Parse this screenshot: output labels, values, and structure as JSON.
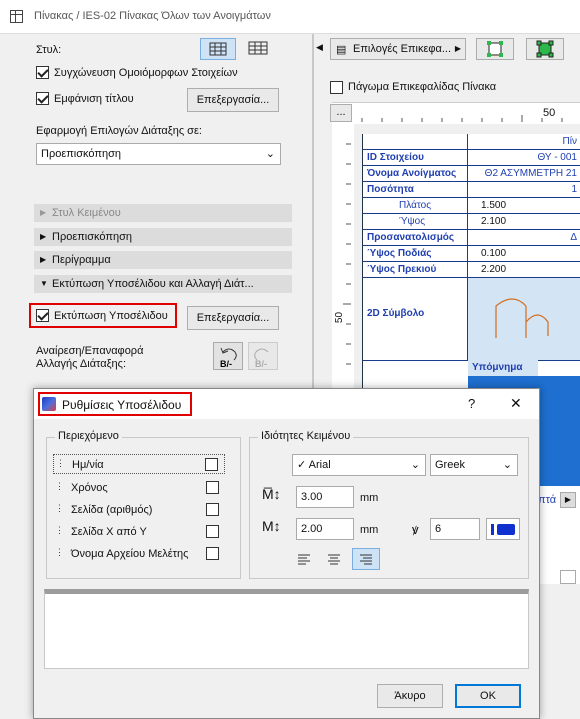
{
  "window": {
    "title": "Πίνακας / IES-02 Πίνακας Όλων των Ανοιγμάτων"
  },
  "left": {
    "style_label": "Στυλ:",
    "merge_label": "Συγχώνευση Ομοιόμορφων Στοιχείων",
    "show_title_label": "Εμφάνιση τίτλου",
    "edit_btn": "Επεξεργασία...",
    "apply_label": "Εφαρμογή Επιλογών Διάταξης σε:",
    "apply_value": "Προεπισκόπηση",
    "sections": [
      "Στυλ Κειμένου",
      "Προεπισκόπηση",
      "Περίγραμμα",
      "Εκτύπωση Υποσέλιδου και Αλλαγή Διάτ..."
    ],
    "print_footer_label": "Εκτύπωση Υποσέλιδου",
    "print_footer_edit_btn": "Επεξεργασία...",
    "undo_label": "Αναίρεση/Επαναφορά Αλλαγής Διάταξης:"
  },
  "right": {
    "options_btn": "Επιλογές Επικεφα...",
    "freeze_label": "Πάγωμα Επικεφαλίδας Πίνακα",
    "ruler_num": "50",
    "vruler_num": "50",
    "dots_btn": "...",
    "table_header": "Πίν",
    "rows": [
      {
        "k": "ID Στοιχείου",
        "v": "ΘΥ - 001"
      },
      {
        "k": "Όνομα Ανοίγματος",
        "v": "Θ2 ΑΣΥΜΜΕΤΡΗ 21"
      },
      {
        "k": "Ποσότητα",
        "v": "1"
      },
      {
        "k": "Πλάτος",
        "v": "1.500"
      },
      {
        "k": "Ύψος",
        "v": "2.100"
      },
      {
        "k": "Προσανατολισμός",
        "v": "Δ"
      },
      {
        "k": "Ύψος Ποδιάς",
        "v": "0.100"
      },
      {
        "k": "Ύψος Πρεκιού",
        "v": "2.200"
      }
    ],
    "symbol_label": "2D Σύμβολο",
    "legend_label": "Υπόμνημα",
    "partial_label": "πτά"
  },
  "dialog": {
    "title": "Ρυθμίσεις Υποσέλιδου",
    "help": "?",
    "close": "✕",
    "contents_title": "Περιεχόμενο",
    "items": [
      {
        "label": "Ημ/νία",
        "checked": false
      },
      {
        "label": "Χρόνος",
        "checked": false
      },
      {
        "label": "Σελίδα (αριθμός)",
        "checked": false
      },
      {
        "label": "Σελίδα Χ από Υ",
        "checked": false
      },
      {
        "label": "Όνομα Αρχείου Μελέτης",
        "checked": false
      }
    ],
    "text_props_title": "Ιδιότητες Κειμένου",
    "font": "Arial",
    "font_check": "✓",
    "charset": "Greek",
    "size1": "3.00",
    "size2": "2.00",
    "unit": "mm",
    "pen": "6",
    "cancel_btn": "Άκυρο",
    "ok_btn": "OK"
  },
  "colors": {
    "accent_red": "#e00000",
    "table_blue": "#1f3fb0",
    "legend_blue": "#1e6fd0",
    "ok_border": "#0078d7"
  }
}
